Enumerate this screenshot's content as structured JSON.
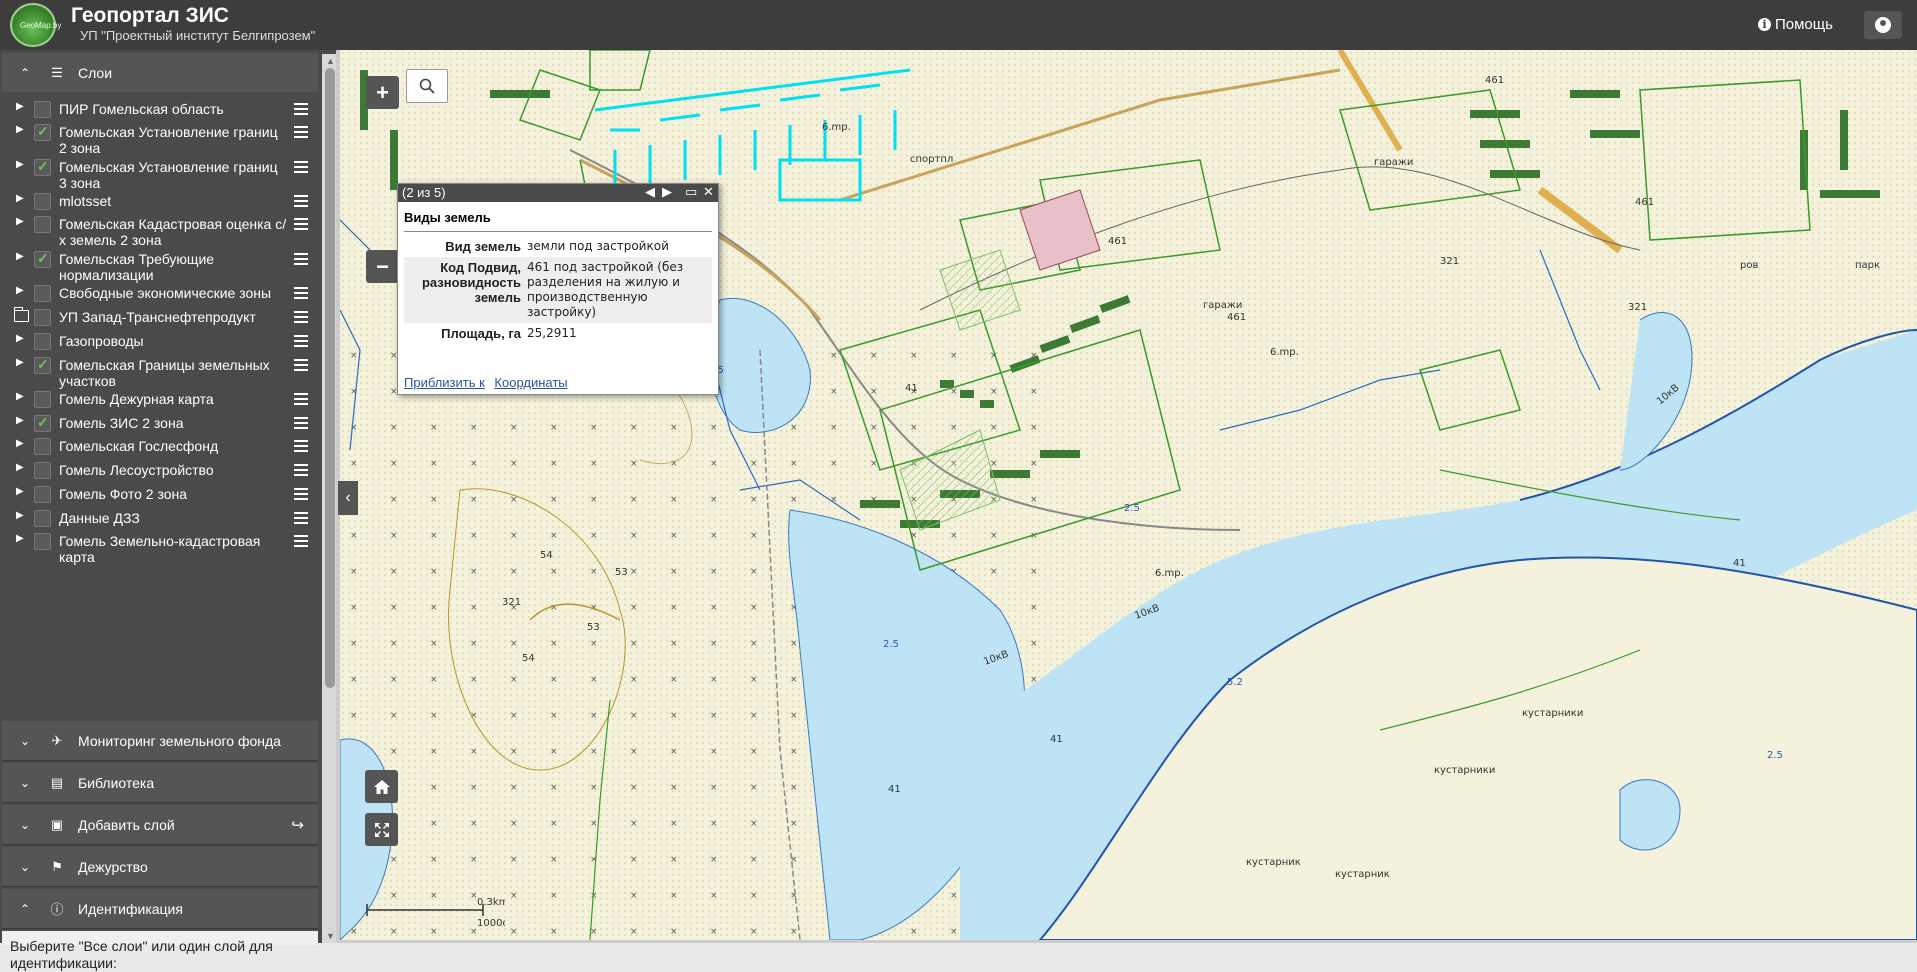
{
  "header": {
    "logo_text": "GeoMap.by",
    "title": "Геопортал ЗИС",
    "subtitle": "УП \"Проектный институт Белгипрозем\"",
    "help_label": "Помощь",
    "help_icon": "info-icon",
    "user_icon": "user-icon"
  },
  "sidebar": {
    "layers_panel": {
      "title": "Слои",
      "icon": "list-icon"
    },
    "layers": [
      {
        "label": "ПИР Гомельская область",
        "checked": false
      },
      {
        "label": "Гомельская Установление границ 2 зона",
        "checked": true
      },
      {
        "label": "Гомельская Установление границ 3 зона",
        "checked": true
      },
      {
        "label": "mlotsset",
        "checked": false
      },
      {
        "label": "Гомельская Кадастровая оценка с/х земель 2 зона",
        "checked": false
      },
      {
        "label": "Гомельская Требующие нормализации",
        "checked": true
      },
      {
        "label": "Свободные экономические зоны",
        "checked": false
      },
      {
        "label": "УП Запад-Транснефтепродукт",
        "checked": false
      },
      {
        "label": "Газопроводы",
        "checked": false
      },
      {
        "label": "Гомельская Границы земельных участков",
        "checked": true
      },
      {
        "label": "Гомель Дежурная карта",
        "checked": false
      },
      {
        "label": "Гомель ЗИС 2 зона",
        "checked": true
      },
      {
        "label": "Гомельская Гослесфонд",
        "checked": false
      },
      {
        "label": "Гомель Лесоустройство",
        "checked": false
      },
      {
        "label": "Гомель Фото 2 зона",
        "checked": false
      },
      {
        "label": "Данные ДЗЗ",
        "checked": false
      },
      {
        "label": "Гомель Земельно-кадастровая карта",
        "checked": false
      }
    ],
    "panels": [
      {
        "label": "Мониторинг земельного фонда",
        "icon": "plane-icon"
      },
      {
        "label": "Библиотека",
        "icon": "book-icon"
      },
      {
        "label": "Добавить слой",
        "icon": "image-icon"
      },
      {
        "label": "Дежурство",
        "icon": "flag-icon"
      },
      {
        "label": "Идентификация",
        "icon": "info-icon"
      }
    ],
    "identification_text": "Выберите \"Все слои\" или один слой для идентификации:"
  },
  "popup": {
    "counter": "(2 из 5)",
    "title": "Виды земель",
    "rows": [
      {
        "key": "Вид земель",
        "value": "земли под застройкой"
      },
      {
        "key": "Код Подвид, разновидность земель",
        "value": "461 под застройкой (без разделения на жилую и производственную застройку)"
      },
      {
        "key": "Площадь, га",
        "value": "25,2911"
      }
    ],
    "zoom_link": "Приблизить к",
    "coords_link": "Координаты"
  },
  "map": {
    "scale_top": "0.3km",
    "scale_bottom": "1000футы",
    "labels": [
      "2.5",
      "2.5",
      "2.5",
      "2.5",
      "5.2",
      "41",
      "41",
      "41",
      "41",
      "461",
      "461",
      "461",
      "461",
      "54",
      "54",
      "53",
      "53",
      "321",
      "321",
      "321",
      "6.mp.",
      "6.mp.",
      "6.mp.",
      "кустарники",
      "кустарники",
      "кустарник",
      "кустарник",
      "гаражи",
      "гаражи",
      "спортпл",
      "10кВ",
      "10кВ",
      "10кВ",
      "парк",
      "ров"
    ]
  },
  "colors": {
    "header_bg": "#3d3d3d",
    "sidebar_bg": "#4a4a4a",
    "water": "#bde3f5",
    "greenery": "#3a9a2a",
    "buildings": "#2f7a2a",
    "highlight": "#00e0f0"
  }
}
